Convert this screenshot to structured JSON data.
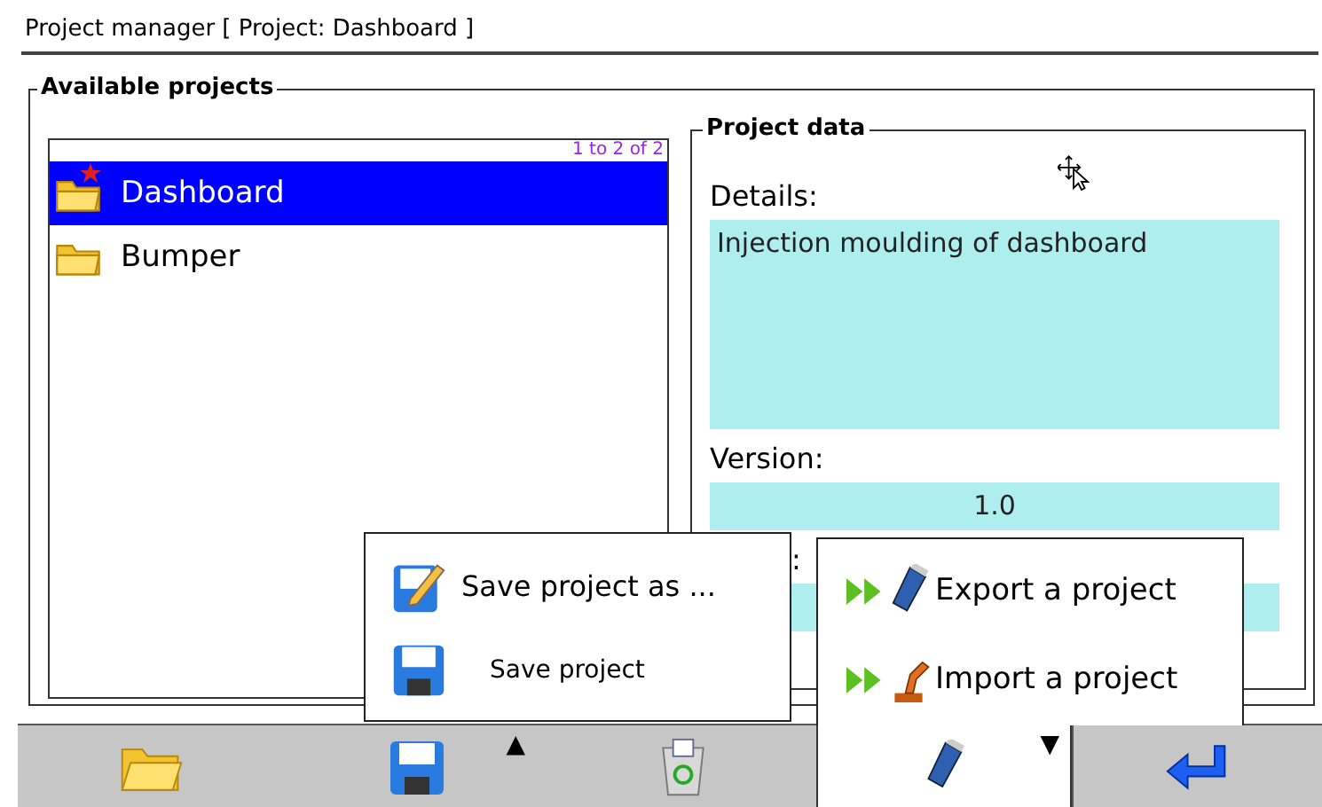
{
  "window": {
    "title": "Project manager [ Project: Dashboard ]"
  },
  "projects": {
    "legend": "Available projects",
    "counter": "1 to 2 of 2",
    "items": [
      {
        "name": "Dashboard",
        "selected": true,
        "active": true
      },
      {
        "name": "Bumper",
        "selected": false,
        "active": false
      }
    ]
  },
  "project_data": {
    "legend": "Project data",
    "fields": [
      {
        "kind": "area",
        "label": "Details:",
        "value": "Injection moulding of dashboard"
      },
      {
        "kind": "line",
        "label": "Version:",
        "value": "1.0"
      },
      {
        "kind": "line",
        "label": ":"
      }
    ]
  },
  "toolbar": [
    {
      "kind": "open"
    },
    {
      "kind": "save",
      "caret": "▲"
    },
    {
      "kind": "delete"
    },
    {
      "kind": "usb",
      "caret": "▼",
      "open": true
    },
    {
      "kind": "enter"
    }
  ],
  "save_menu": [
    {
      "kind": "save-as",
      "label": "Save project as ..."
    },
    {
      "kind": "save",
      "label": "Save project"
    }
  ],
  "transfer_menu": [
    {
      "kind": "export",
      "label": "Export a project"
    },
    {
      "kind": "import",
      "label": "Import a project"
    }
  ]
}
